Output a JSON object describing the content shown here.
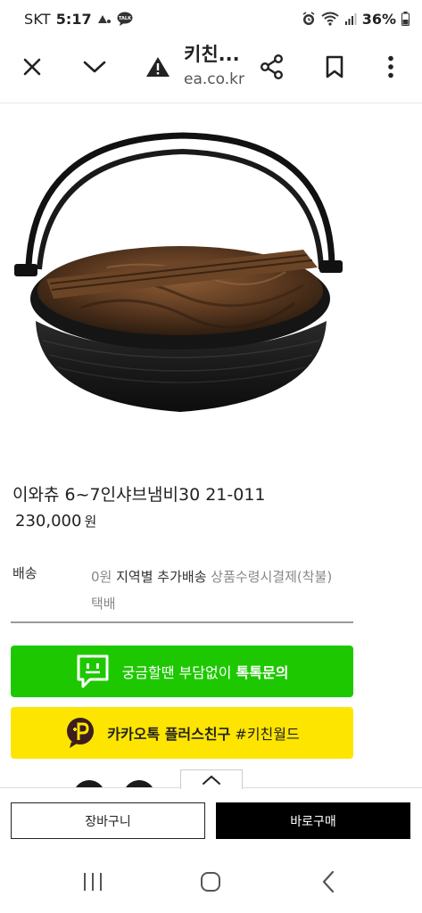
{
  "status_bar": {
    "carrier": "SKT",
    "time": "5:17",
    "battery_percent": "36%",
    "icons": [
      "signal-a-icon",
      "talk-icon",
      "alarm-icon",
      "wifi-icon",
      "cellular-icon",
      "battery-icon"
    ],
    "talk_badge": "TALK"
  },
  "browser": {
    "page_title": "키친...",
    "domain": "ea.co.kr",
    "icons": [
      "close-icon",
      "chevron-down-icon",
      "warning-icon",
      "share-icon",
      "bookmark-icon",
      "more-icon"
    ]
  },
  "product": {
    "name": "이와츄 6~7인샤브냄비30 21-011",
    "price": "230,000",
    "price_unit": "원",
    "image_icon": "cast-iron-pot-with-wooden-lid-image"
  },
  "shipping": {
    "label": "배송",
    "fee": "0원",
    "regional_extra": "지역별 추가배송",
    "payment_note": "상품수령시결제(착불)",
    "method": "택배"
  },
  "buttons": {
    "talk_prefix": "궁금할땐 부담없이",
    "talk_strong": "톡톡문의",
    "kakao_strong": "카카오톡 플러스친구",
    "kakao_suffix": "#키친월드",
    "cart": "장바구니",
    "buy": "바로구매"
  },
  "colors": {
    "talk_green": "#1ec800",
    "kakao_yellow": "#fee500",
    "buy_black": "#000000"
  },
  "nav": {
    "icons": [
      "recent-apps-icon",
      "home-icon",
      "back-icon"
    ]
  }
}
